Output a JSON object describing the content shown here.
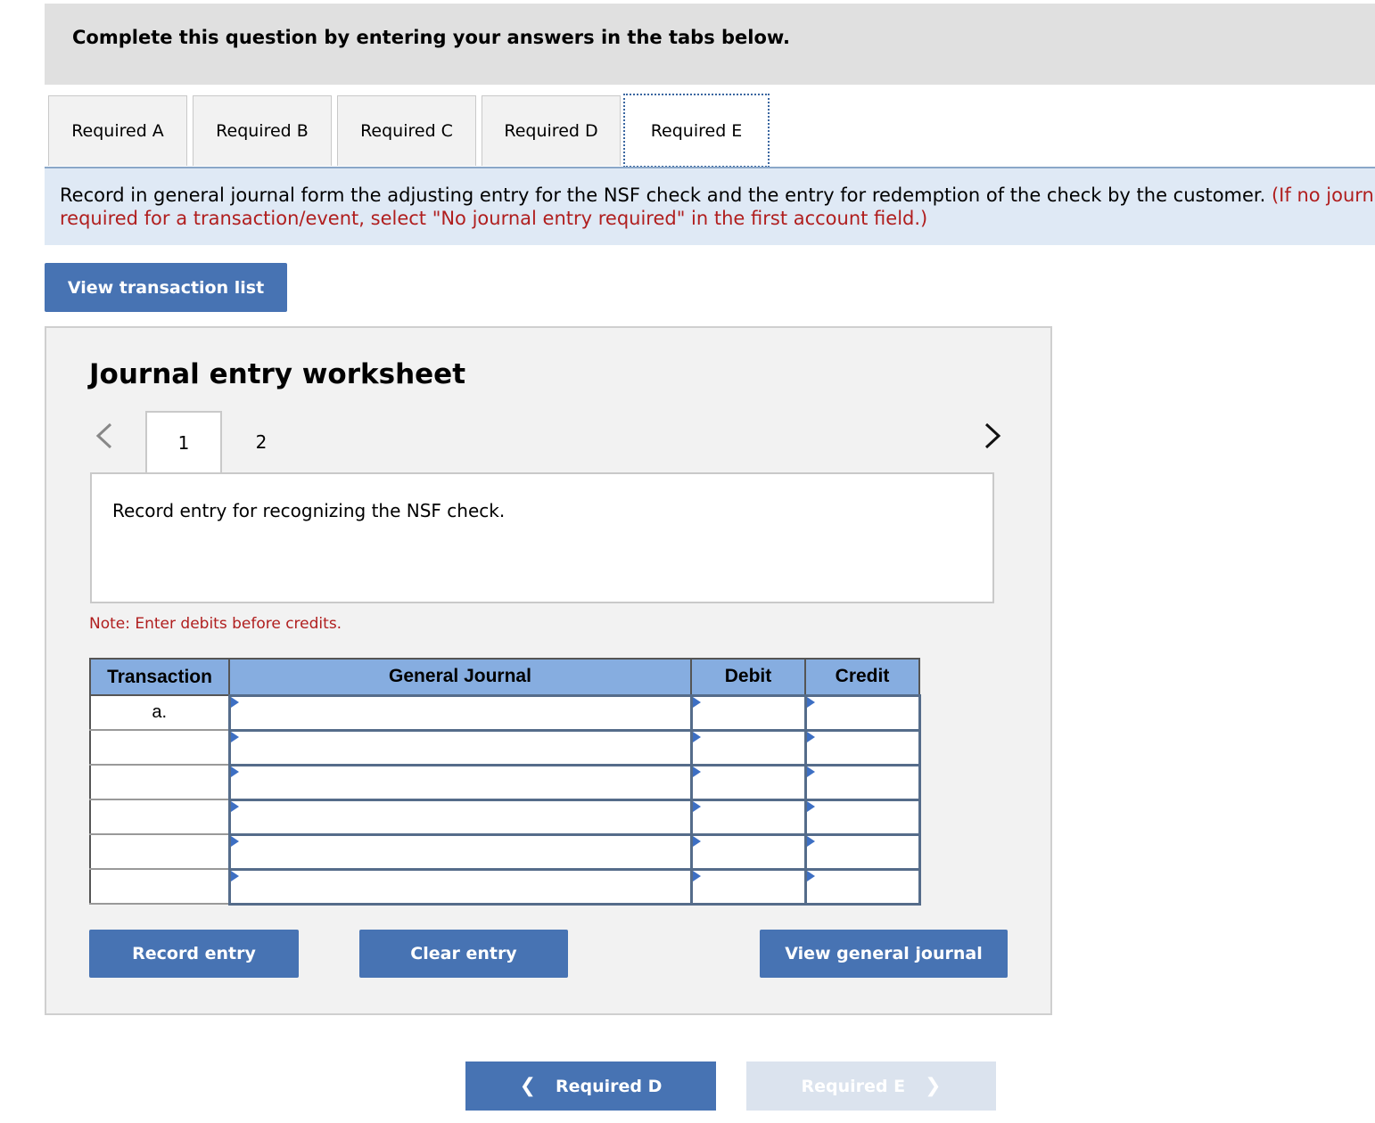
{
  "header": {
    "title": "Complete this question by entering your answers in the tabs below."
  },
  "tabs": [
    {
      "label": "Required A",
      "active": false
    },
    {
      "label": "Required B",
      "active": false
    },
    {
      "label": "Required C",
      "active": false
    },
    {
      "label": "Required D",
      "active": false
    },
    {
      "label": "Required E",
      "active": true
    }
  ],
  "instruction": {
    "text": "Record in general journal form the adjusting entry for the NSF check and the entry for redemption of the check by the customer.",
    "note_visible": "(If no journal entry is required for a transaction/event, select \"No journal entry required\" in the first account field.)"
  },
  "buttons": {
    "view_transaction_list": "View transaction list",
    "record_entry": "Record entry",
    "clear_entry": "Clear entry",
    "view_general_journal": "View general journal"
  },
  "worksheet": {
    "title": "Journal entry worksheet",
    "pages": [
      "1",
      "2"
    ],
    "active_page": "1",
    "description": "Record entry for recognizing the NSF check.",
    "note": "Note: Enter debits before credits.",
    "columns": [
      "Transaction",
      "General Journal",
      "Debit",
      "Credit"
    ],
    "rows": [
      {
        "transaction": "a.",
        "account": "",
        "debit": "",
        "credit": ""
      },
      {
        "transaction": "",
        "account": "",
        "debit": "",
        "credit": ""
      },
      {
        "transaction": "",
        "account": "",
        "debit": "",
        "credit": ""
      },
      {
        "transaction": "",
        "account": "",
        "debit": "",
        "credit": ""
      },
      {
        "transaction": "",
        "account": "",
        "debit": "",
        "credit": ""
      },
      {
        "transaction": "",
        "account": "",
        "debit": "",
        "credit": ""
      }
    ]
  },
  "footer_nav": {
    "prev_label": "Required D",
    "next_label": "Required E"
  },
  "icons": {
    "prev": "chevron-left-icon",
    "next": "chevron-right-icon"
  },
  "colors": {
    "primary_button": "#4773b3",
    "table_header": "#86ade0",
    "instruction_bg": "#dfe9f5",
    "note_red": "#b01e1e",
    "disabled_button": "#dbe3ee"
  }
}
